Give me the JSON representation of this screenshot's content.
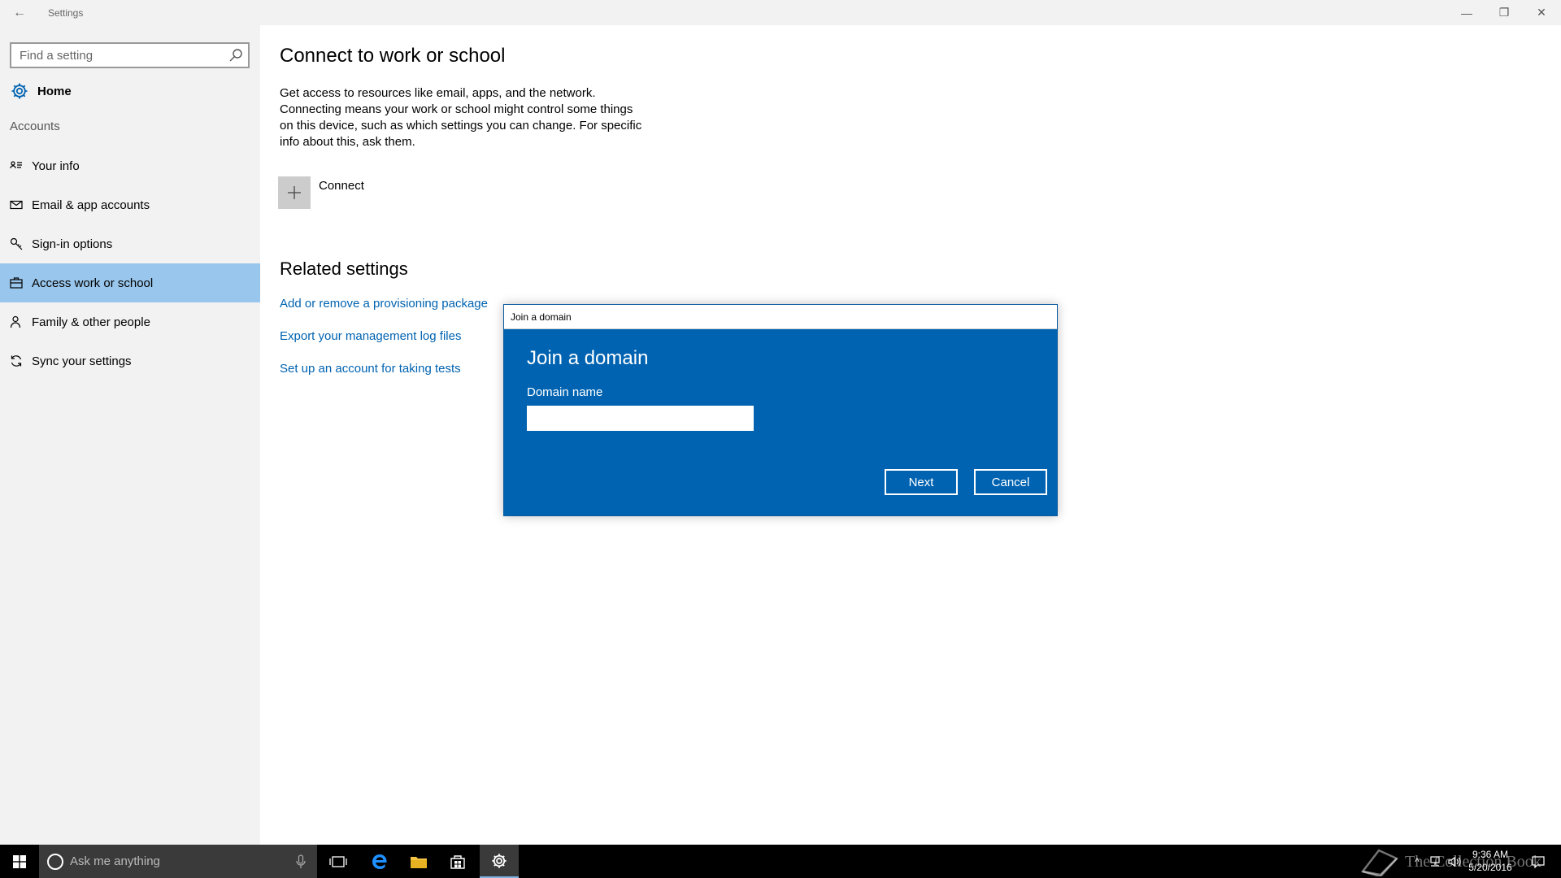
{
  "window": {
    "title": "Settings",
    "back_glyph": "←",
    "minimize_glyph": "—",
    "restore_glyph": "❐",
    "close_glyph": "✕"
  },
  "sidebar": {
    "search_placeholder": "Find a setting",
    "home_label": "Home",
    "section_label": "Accounts",
    "items": [
      {
        "label": "Your info",
        "icon": "contact-card-icon"
      },
      {
        "label": "Email & app accounts",
        "icon": "mail-icon"
      },
      {
        "label": "Sign-in options",
        "icon": "key-icon"
      },
      {
        "label": "Access work or school",
        "icon": "briefcase-icon",
        "selected": true
      },
      {
        "label": "Family & other people",
        "icon": "person-icon"
      },
      {
        "label": "Sync your settings",
        "icon": "sync-icon"
      }
    ]
  },
  "main": {
    "title": "Connect to work or school",
    "description": "Get access to resources like email, apps, and the network. Connecting means your work or school might control some things on this device, such as which settings you can change. For specific info about this, ask them.",
    "connect_label": "Connect",
    "related_title": "Related settings",
    "links": [
      "Add or remove a provisioning package",
      "Export your management log files",
      "Set up an account for taking tests"
    ]
  },
  "dialog": {
    "window_title": "Join a domain",
    "heading": "Join a domain",
    "field_label": "Domain name",
    "field_value": "",
    "next_label": "Next",
    "cancel_label": "Cancel"
  },
  "taskbar": {
    "search_placeholder": "Ask me anything",
    "time": "9:36 AM",
    "date": "5/20/2016",
    "watermark": "The Collection Book"
  },
  "colors": {
    "accent": "#0063b1",
    "selected_nav": "#99c6ec",
    "sidebar_bg": "#f2f2f2",
    "taskbar_bg": "#000000"
  }
}
